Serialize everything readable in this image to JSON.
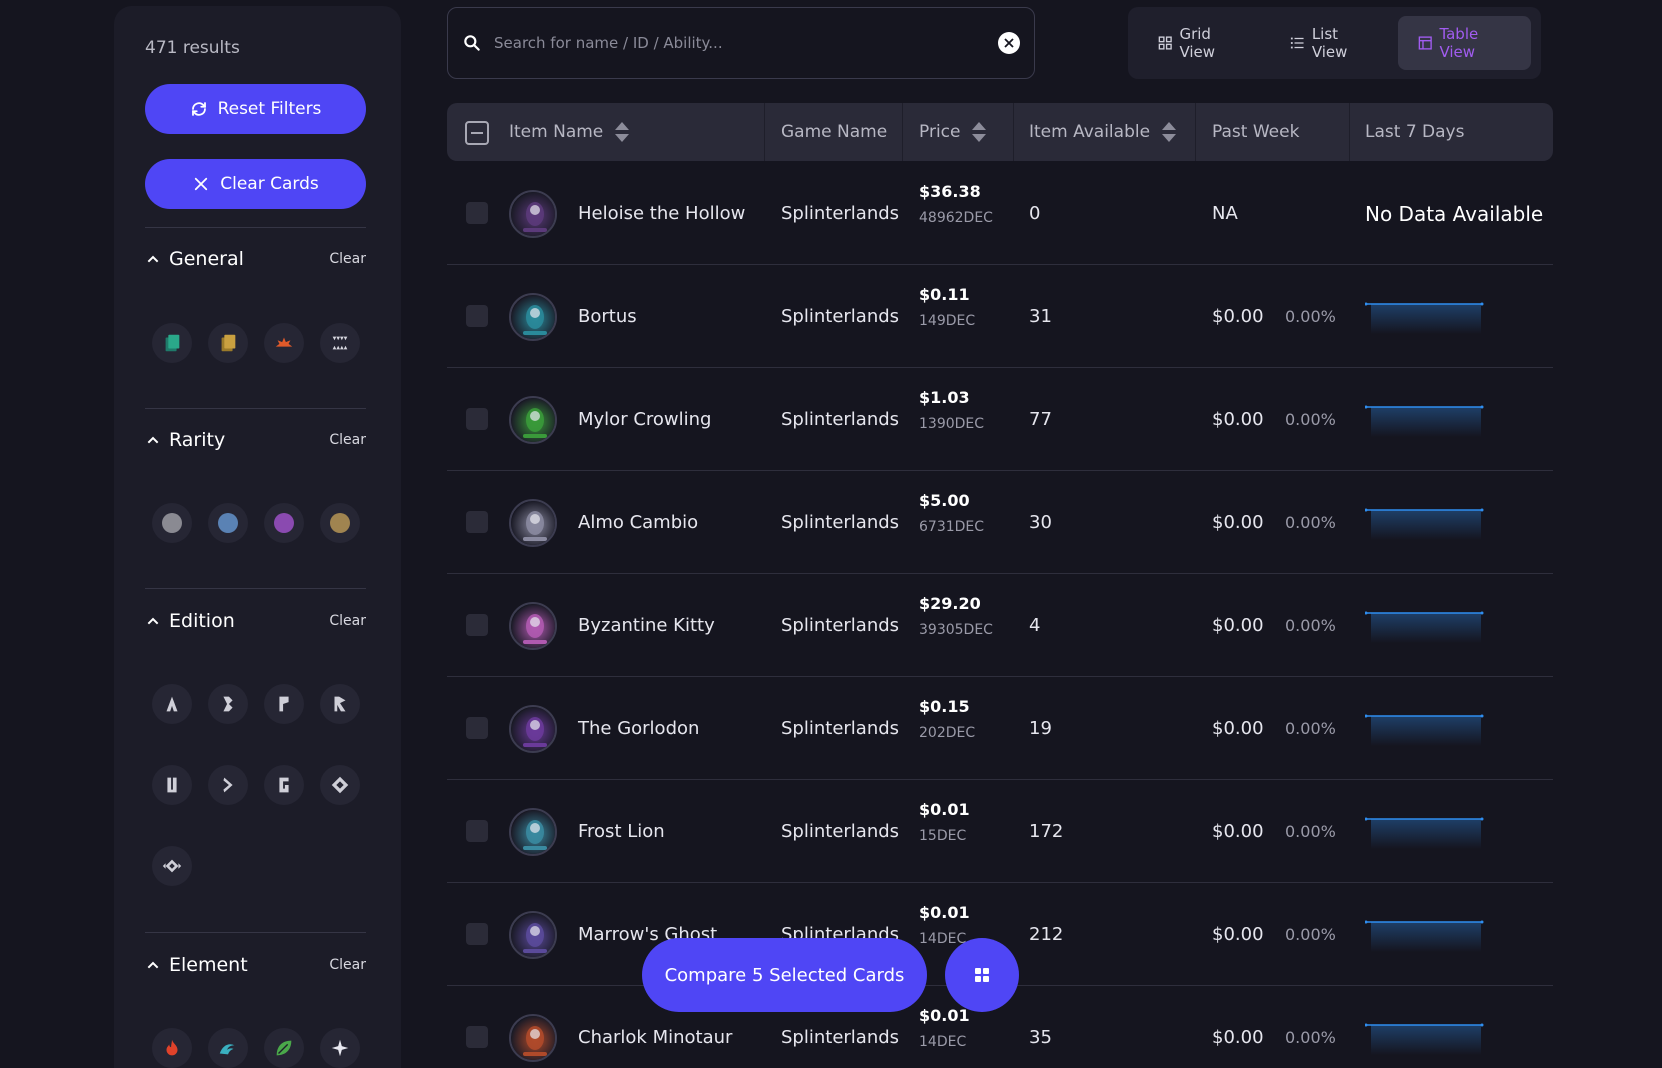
{
  "sidebar": {
    "results": "471 results",
    "reset_label": "Reset Filters",
    "clear_cards_label": "Clear Cards",
    "sections": {
      "general": {
        "title": "General",
        "clear": "Clear",
        "icons": [
          "green-card-icon",
          "gold-card-icon",
          "fire-burst-icon",
          "teeth-icon"
        ]
      },
      "rarity": {
        "title": "Rarity",
        "clear": "Clear",
        "colors": [
          "#8a8a92",
          "#5a82b4",
          "#8a4ab0",
          "#a08450"
        ]
      },
      "edition": {
        "title": "Edition",
        "clear": "Clear",
        "icons": [
          "alpha-icon",
          "beta-icon",
          "promo-icon",
          "reward-icon",
          "untamed-icon",
          "dice-icon",
          "gladius-icon",
          "chaos-icon",
          "rift-icon"
        ]
      },
      "element": {
        "title": "Element",
        "clear": "Clear",
        "icons": [
          "fire-icon",
          "water-icon",
          "earth-icon",
          "life-icon"
        ]
      }
    }
  },
  "search": {
    "placeholder": "Search for name / ID / Ability..."
  },
  "views": {
    "grid": "Grid View",
    "list": "List View",
    "table": "Table View",
    "active_color": "#a15cf0"
  },
  "table": {
    "headers": {
      "item_name": "Item Name",
      "game_name": "Game Name",
      "price": "Price",
      "item_available": "Item Available",
      "past_week": "Past Week",
      "last_7_days": "Last 7 Days"
    },
    "rows": [
      {
        "name": "Heloise the Hollow",
        "game": "Splinterlands",
        "usd": "$36.38",
        "dec": "48962DEC",
        "available": "0",
        "past_week": "NA",
        "pct": "",
        "last7": "No Data Available",
        "avatar_color": "#5b3a7a"
      },
      {
        "name": "Bortus",
        "game": "Splinterlands",
        "usd": "$0.11",
        "dec": "149DEC",
        "available": "31",
        "past_week": "$0.00",
        "pct": "0.00%",
        "last7": "",
        "avatar_color": "#2a8a9a"
      },
      {
        "name": "Mylor Crowling",
        "game": "Splinterlands",
        "usd": "$1.03",
        "dec": "1390DEC",
        "available": "77",
        "past_week": "$0.00",
        "pct": "0.00%",
        "last7": "",
        "avatar_color": "#3a9a3a"
      },
      {
        "name": "Almo Cambio",
        "game": "Splinterlands",
        "usd": "$5.00",
        "dec": "6731DEC",
        "available": "30",
        "past_week": "$0.00",
        "pct": "0.00%",
        "last7": "",
        "avatar_color": "#8a8aa0"
      },
      {
        "name": "Byzantine Kitty",
        "game": "Splinterlands",
        "usd": "$29.20",
        "dec": "39305DEC",
        "available": "4",
        "past_week": "$0.00",
        "pct": "0.00%",
        "last7": "",
        "avatar_color": "#b05ab0"
      },
      {
        "name": "The Gorlodon",
        "game": "Splinterlands",
        "usd": "$0.15",
        "dec": "202DEC",
        "available": "19",
        "past_week": "$0.00",
        "pct": "0.00%",
        "last7": "",
        "avatar_color": "#6a3a9a"
      },
      {
        "name": "Frost Lion",
        "game": "Splinterlands",
        "usd": "$0.01",
        "dec": "15DEC",
        "available": "172",
        "past_week": "$0.00",
        "pct": "0.00%",
        "last7": "",
        "avatar_color": "#3a8aa0"
      },
      {
        "name": "Marrow's Ghost",
        "game": "Splinterlands",
        "usd": "$0.01",
        "dec": "14DEC",
        "available": "212",
        "past_week": "$0.00",
        "pct": "0.00%",
        "last7": "",
        "avatar_color": "#5a4a9a"
      },
      {
        "name": "Charlok Minotaur",
        "game": "Splinterlands",
        "usd": "$0.01",
        "dec": "14DEC",
        "available": "35",
        "past_week": "$0.00",
        "pct": "0.00%",
        "last7": "",
        "avatar_color": "#b04a2a"
      }
    ]
  },
  "compare": {
    "label": "Compare 5 Selected Cards"
  },
  "colors": {
    "accent": "#4f46f5",
    "spark": "#2f8ef0"
  }
}
